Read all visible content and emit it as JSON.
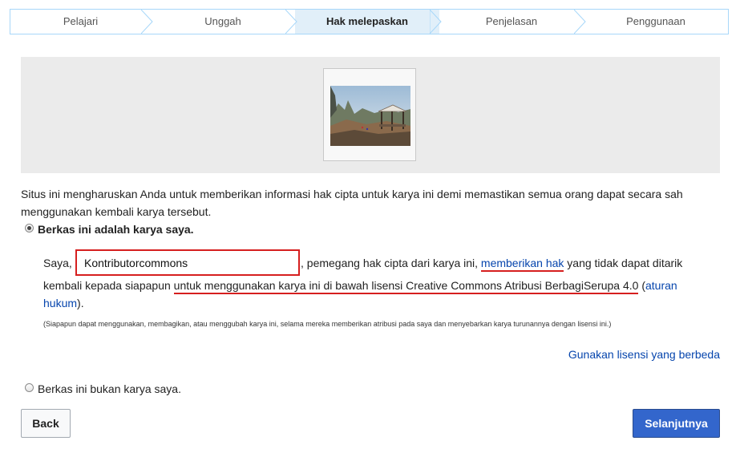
{
  "steps": [
    {
      "label": "Pelajari",
      "active": false
    },
    {
      "label": "Unggah",
      "active": false
    },
    {
      "label": "Hak melepaskan",
      "active": true
    },
    {
      "label": "Penjelasan",
      "active": false
    },
    {
      "label": "Penggunaan",
      "active": false
    }
  ],
  "intro_text": "Situs ini mengharuskan Anda untuk memberikan informasi hak cipta untuk karya ini demi memastikan semua orang dapat secara sah menggunakan kembali karya tersebut.",
  "own_work": {
    "selected": true,
    "label": "Berkas ini adalah karya saya.",
    "saya": "Saya,",
    "author_value": "Kontributorcommons",
    "after_input": ", pemegang hak cipta dari karya ini, ",
    "grant_link": "memberikan hak",
    "after_grant": " yang tidak dapat ditarik",
    "line2_prefix": "kembali kepada siapapun ",
    "license_link": "untuk menggunakan karya ini di bawah lisensi Creative Commons Atribusi BerbagiSerupa 4.0",
    "paren_open": " (",
    "legal_link_part1": "aturan",
    "legal_link_part2": "hukum",
    "paren_close": ").",
    "note": "(Siapapun dapat menggunakan, membagikan, atau menggubah karya ini, selama mereka memberikan atribusi pada saya dan menyebarkan karya turunannya dengan lisensi ini.)",
    "different_license": "Gunakan lisensi yang berbeda"
  },
  "not_own_work": {
    "selected": false,
    "label": "Berkas ini bukan karya saya."
  },
  "buttons": {
    "back": "Back",
    "next": "Selanjutnya"
  },
  "colors": {
    "steps_border": "#a7d7f9",
    "active_step_bg": "#e1eff9",
    "link": "#0645ad",
    "highlight_red": "#d61f1f",
    "primary_button": "#3366cc"
  },
  "icons": [
    "radio-checked-icon",
    "radio-unchecked-icon",
    "landscape-thumbnail"
  ]
}
